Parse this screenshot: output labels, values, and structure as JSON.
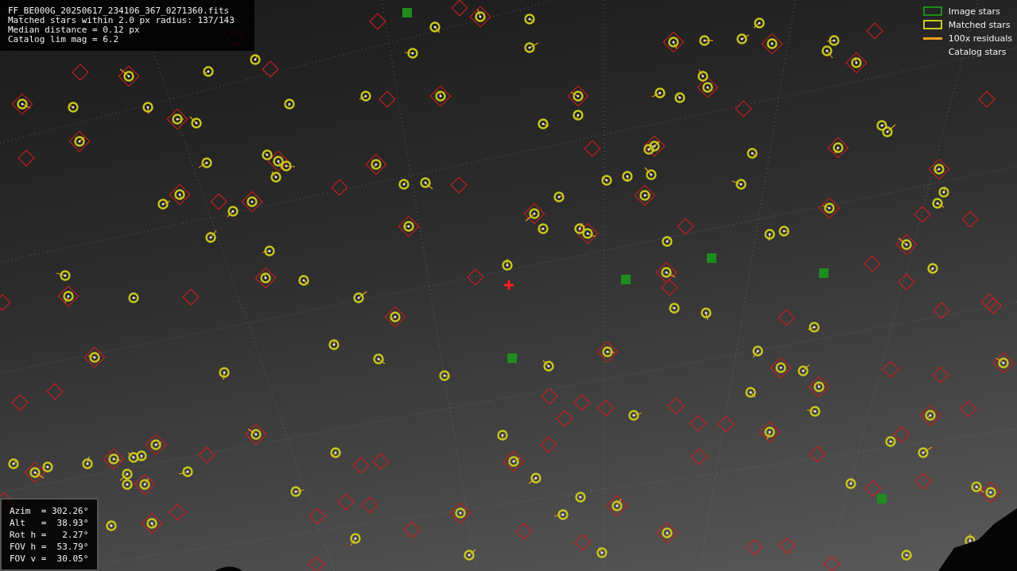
{
  "info_lines": [
    "FF_BE000G_20250617_234106_367_0271360.fits",
    "Matched stars within 2.0 px radius: 137/143",
    "Median distance = 0.12 px",
    "Catalog lim mag = 6.2"
  ],
  "legend": [
    {
      "kind": "box",
      "label": "Image stars",
      "color": "#1e8c1e"
    },
    {
      "kind": "box",
      "label": "Matched stars",
      "color": "#c8c81e"
    },
    {
      "kind": "line",
      "label": "100x residuals",
      "color": "#f0a01e"
    },
    {
      "kind": "none",
      "label": "Catalog stars"
    }
  ],
  "pointing": [
    "Azim  = 302.26°",
    "Alt   =  38.93°",
    "Rot h =   2.27°",
    "FOV h =  53.79°",
    "FOV v =  30.05°"
  ]
}
